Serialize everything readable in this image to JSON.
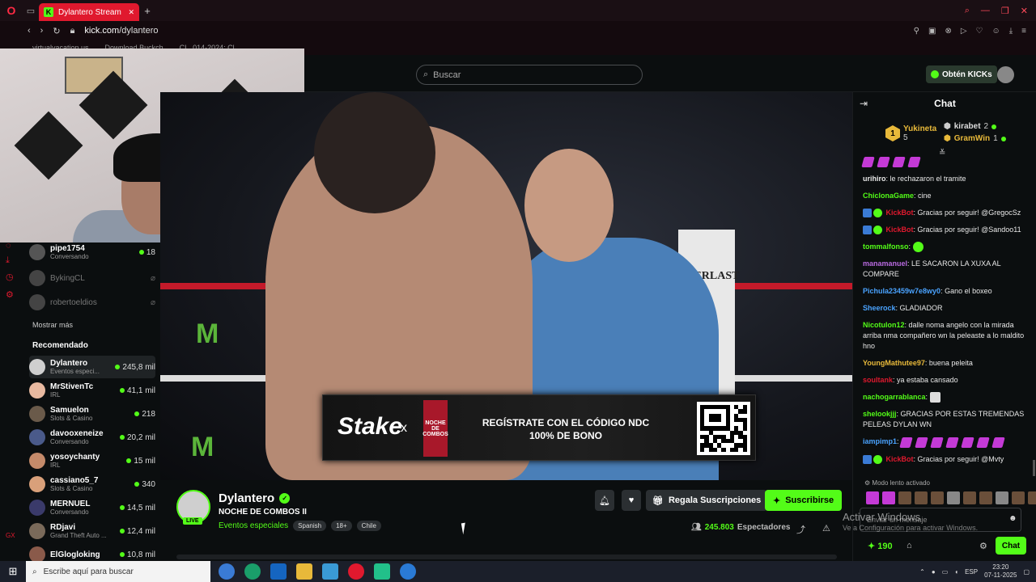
{
  "browser": {
    "tab_title": "Dylantero Stream - W...",
    "url_scheme_host": "kick.com",
    "url_path": "/dylantero",
    "bookmarks": [
      "virtualvacation.us",
      "Download Buckch",
      "CL_014-2024: Cl"
    ]
  },
  "header": {
    "search_placeholder": "Buscar",
    "kicks_button": "Obtén KICKs"
  },
  "sidebar": {
    "following_tail": [
      {
        "name": "pipe1754",
        "sub": "Conversando",
        "count": "18",
        "live": true
      },
      {
        "name": "BykingCL",
        "sub": "",
        "count": "",
        "live": false
      },
      {
        "name": "robertoeldios",
        "sub": "",
        "count": "",
        "live": false
      }
    ],
    "show_more": "Mostrar más",
    "recommended_heading": "Recomendado",
    "recommended": [
      {
        "name": "Dylantero",
        "sub": "Eventos especi...",
        "count": "245,8 mil"
      },
      {
        "name": "MrStivenTc",
        "sub": "IRL",
        "count": "41,1 mil"
      },
      {
        "name": "Samuelon",
        "sub": "Slots & Casino",
        "count": "218"
      },
      {
        "name": "davooxeneize",
        "sub": "Conversando",
        "count": "20,2 mil"
      },
      {
        "name": "yosoychanty",
        "sub": "IRL",
        "count": "15 mil"
      },
      {
        "name": "cassiano5_7",
        "sub": "Slots & Casino",
        "count": "340"
      },
      {
        "name": "MERNUEL",
        "sub": "Conversando",
        "count": "14,5 mil"
      },
      {
        "name": "RDjavi",
        "sub": "Grand Theft Auto ...",
        "count": "12,4 mil"
      },
      {
        "name": "ElGlogloking",
        "sub": "",
        "count": "10,8 mil"
      }
    ]
  },
  "video": {
    "ring_brand": "EVERLAST",
    "banner_brand": "Stake",
    "banner_x": "x",
    "banner_event_logo": "NOCHE DE COMBOS",
    "banner_line1_pre": "REGÍSTRATE CON EL CÓDIGO ",
    "banner_code": "NDC",
    "banner_line2": "100% DE BONO"
  },
  "stream": {
    "streamer": "Dylantero",
    "live_badge": "LIVE",
    "title": "NOCHE DE COMBOS II",
    "category": "Eventos especiales",
    "tags": [
      "Spanish",
      "18+",
      "Chile"
    ],
    "gift_button": "Regala Suscripciones",
    "subscribe_button": "Suscribirse",
    "viewers_count": "245.803",
    "viewers_label": "Espectadores"
  },
  "chat": {
    "title": "Chat",
    "leaderboard": [
      {
        "rank": "1",
        "name": "Yukineta",
        "value": "5"
      },
      {
        "name": "kirabet",
        "value": "2"
      },
      {
        "name": "GramWin",
        "value": "1"
      }
    ],
    "messages": [
      {
        "user": "urihiro",
        "color": "#e8e8e8",
        "text": "le rechazaron el tramite"
      },
      {
        "user": "ChiclonaGame",
        "color": "#53fc18",
        "text": "cine"
      },
      {
        "user": "KickBot",
        "color": "#e0192e",
        "text": "Gracias por seguir! @GregocSz",
        "bot": true
      },
      {
        "user": "KickBot",
        "color": "#e0192e",
        "text": "Gracias por seguir! @Sandoo11",
        "bot": true
      },
      {
        "user": "tommalfonso",
        "color": "#53fc18",
        "text": ""
      },
      {
        "user": "manamanuel",
        "color": "#b86ae0",
        "text": "LE SACARON LA XUXA AL COMPARE"
      },
      {
        "user": "Pichula23459w7e8wy0",
        "color": "#4aa3ff",
        "text": "Gano el boxeo"
      },
      {
        "user": "Sheerock",
        "color": "#4aa3ff",
        "text": "GLADIADOR"
      },
      {
        "user": "Nicotulon12",
        "color": "#53fc18",
        "text": "dalle noma angelo con la mirada arriba nma compañero wn la peleaste a lo maldito hno"
      },
      {
        "user": "YoungMathutee97",
        "color": "#e8b93a",
        "text": "buena peleita"
      },
      {
        "user": "soultank",
        "color": "#e0192e",
        "text": "ya estaba cansado"
      },
      {
        "user": "nachogarrablanca",
        "color": "#53fc18",
        "text": ""
      },
      {
        "user": "shelookjjj",
        "color": "#53fc18",
        "text": "GRACIAS POR ESTAS TREMENDAS PELEAS DYLAN WN"
      },
      {
        "user": "iampimp1",
        "color": "#4aa3ff",
        "text": ""
      },
      {
        "user": "KickBot",
        "color": "#e0192e",
        "text": "Gracias por seguir! @Mvty",
        "bot": true
      }
    ],
    "slow_mode": "Modo lento activado",
    "input_placeholder": "Enviar un mensaje",
    "kicks_balance": "190",
    "send_button": "Chat"
  },
  "windows": {
    "activate_title": "Activar Windows",
    "activate_sub": "Ve a Configuración para activar Windows.",
    "search_placeholder": "Escribe aquí para buscar",
    "language": "ESP",
    "time": "23:20",
    "date": "07-11-2025"
  },
  "colors": {
    "kick_green": "#53fc18",
    "opera_red": "#e0192e",
    "background": "#0b0e0f"
  }
}
